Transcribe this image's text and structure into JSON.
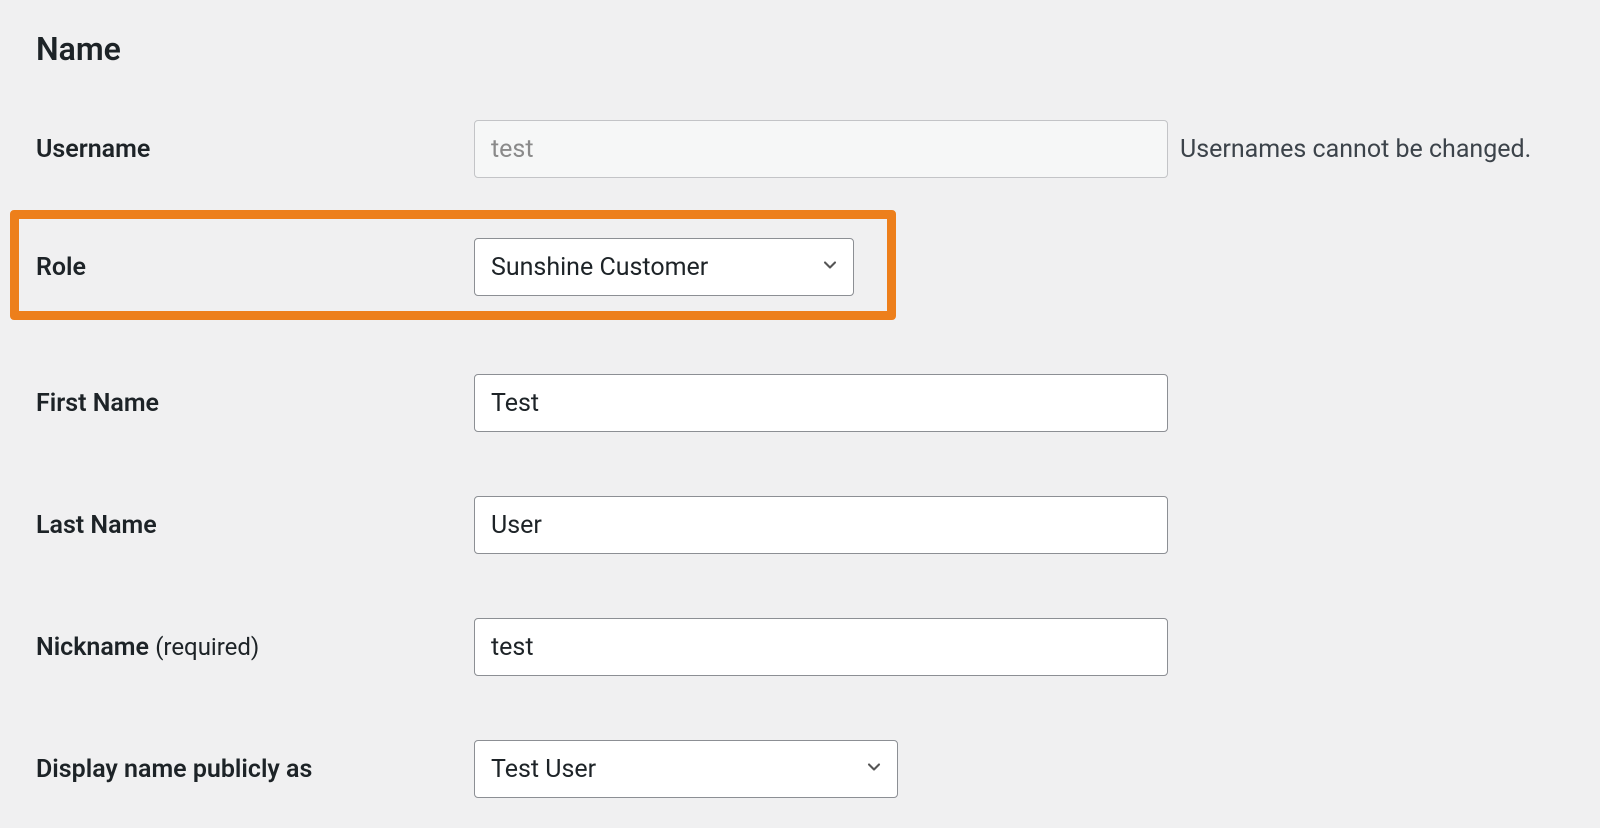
{
  "section": {
    "title": "Name"
  },
  "fields": {
    "username": {
      "label": "Username",
      "value": "test",
      "helper": "Usernames cannot be changed."
    },
    "role": {
      "label": "Role",
      "value": "Sunshine Customer"
    },
    "first_name": {
      "label": "First Name",
      "value": "Test"
    },
    "last_name": {
      "label": "Last Name",
      "value": "User"
    },
    "nickname": {
      "label": "Nickname",
      "required_text": "(required)",
      "value": "test"
    },
    "display_name": {
      "label": "Display name publicly as",
      "value": "Test User"
    }
  }
}
